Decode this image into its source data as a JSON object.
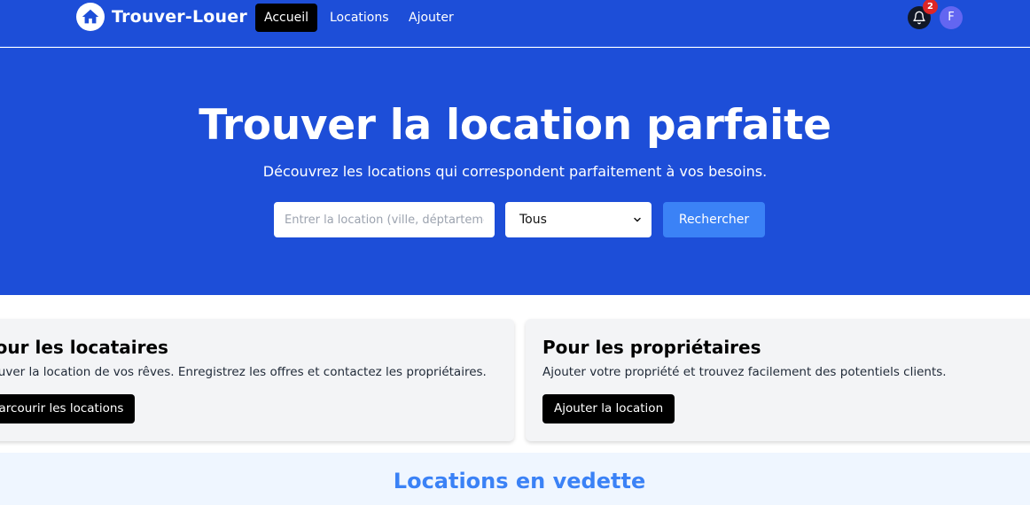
{
  "nav": {
    "brand": "Trouver-Louer",
    "links": [
      {
        "label": "Accueil",
        "active": true
      },
      {
        "label": "Locations",
        "active": false
      },
      {
        "label": "Ajouter",
        "active": false
      }
    ],
    "notification_count": "2",
    "avatar_initial": "F"
  },
  "hero": {
    "title": "Trouver la location parfaite",
    "subtitle": "Découvrez les locations qui correspondent parfaitement à vos besoins.",
    "search_placeholder": "Entrer la location (ville, déptartement)",
    "type_select_value": "Tous",
    "search_button": "Rechercher"
  },
  "cards": [
    {
      "title": "Pour les locataires",
      "text": "Trouver la location de vos rêves. Enregistrez les offres et contactez les propriétaires.",
      "button": "Parcourir les locations"
    },
    {
      "title": "Pour les propriétaires",
      "text": "Ajouter votre propriété et trouvez facilement des potentiels clients.",
      "button": "Ajouter la location"
    }
  ],
  "featured": {
    "title": "Locations en vedette"
  },
  "colors": {
    "primary": "#1d4ed8",
    "accent": "#3b82f6",
    "badge": "#dc2626",
    "avatar": "#6366f1"
  },
  "icons": {
    "logo": "house-icon",
    "notifications": "bell-icon",
    "select": "chevron-down-icon"
  }
}
